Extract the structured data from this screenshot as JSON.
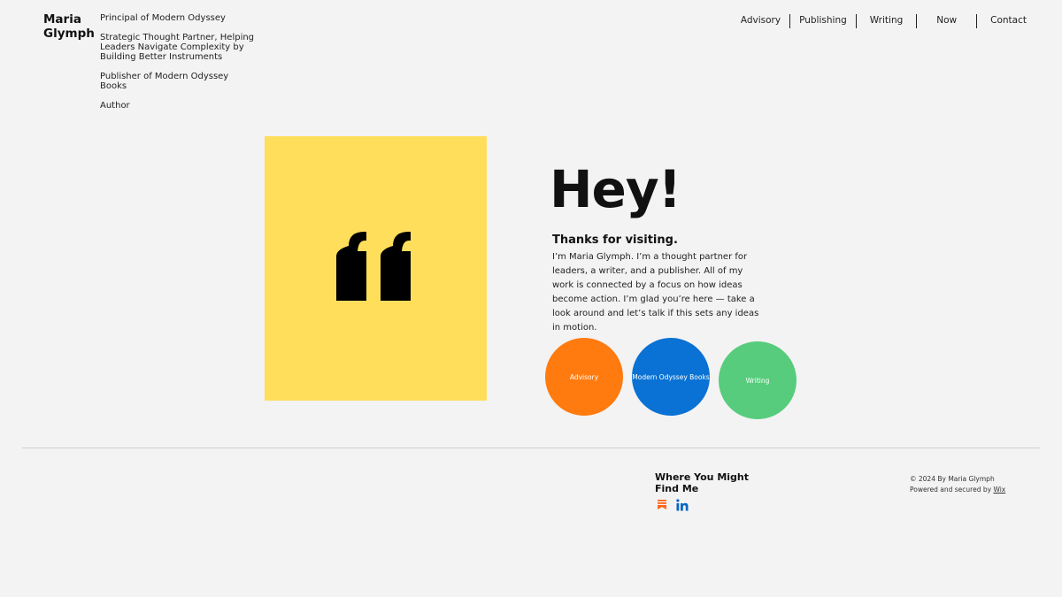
{
  "header": {
    "site_name": "Maria Glymph",
    "taglines": [
      "Principal of Modern Odyssey",
      "Strategic Thought Partner, Helping Leaders Navigate Complexity by Building Better Instruments",
      "Publisher of Modern Odyssey Books",
      "Author"
    ]
  },
  "nav": {
    "items": [
      "Advisory",
      "Publishing",
      "Writing",
      "Now",
      "Contact"
    ]
  },
  "hero": {
    "quote_icon": "quote-icon",
    "quote_color": "#ffde5c",
    "heading": "Hey!",
    "subheading": "Thanks for visiting.",
    "intro": "I’m Maria Glymph. I’m a thought partner for leaders, a writer, and a publisher. All of my work is connected by a focus on how ideas become action. I’m glad you’re here — take a look around and let’s talk if this sets any ideas in motion."
  },
  "circles": [
    {
      "label": "Advisory",
      "color": "#ff7b0f"
    },
    {
      "label": "Modern Odyssey Books",
      "color": "#0a72d4"
    },
    {
      "label": "Writing",
      "color": "#57cc7c"
    }
  ],
  "footer": {
    "find_title": "Where You Might Find Me",
    "social_icons": [
      "substack-icon",
      "linkedin-icon"
    ],
    "copyright": "© 2024 By Maria Glymph",
    "powered_prefix": "Powered and secured by",
    "powered_link": "Wix"
  }
}
